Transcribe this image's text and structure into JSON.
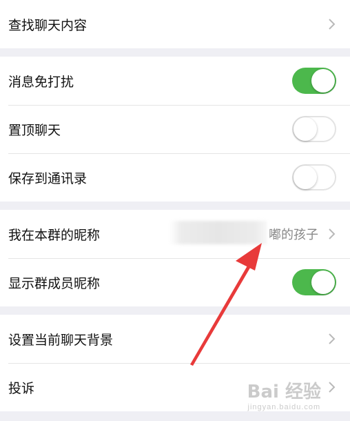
{
  "rows": {
    "search": {
      "label": "查找聊天内容"
    },
    "mute": {
      "label": "消息免打扰",
      "toggle": "on"
    },
    "pin": {
      "label": "置顶聊天",
      "toggle": "off"
    },
    "save": {
      "label": "保存到通讯录",
      "toggle": "off"
    },
    "nickname": {
      "label": "我在本群的昵称",
      "value": "嘟的孩子"
    },
    "show_nicknames": {
      "label": "显示群成员昵称",
      "toggle": "on"
    },
    "background": {
      "label": "设置当前聊天背景"
    },
    "report": {
      "label": "投诉"
    }
  },
  "watermark": {
    "brand": "Bai 经验",
    "url": "jingyan.baidu.com"
  },
  "colors": {
    "toggle_on": "#4cb84c",
    "arrow": "#e83a3a",
    "background": "#efeff4"
  }
}
